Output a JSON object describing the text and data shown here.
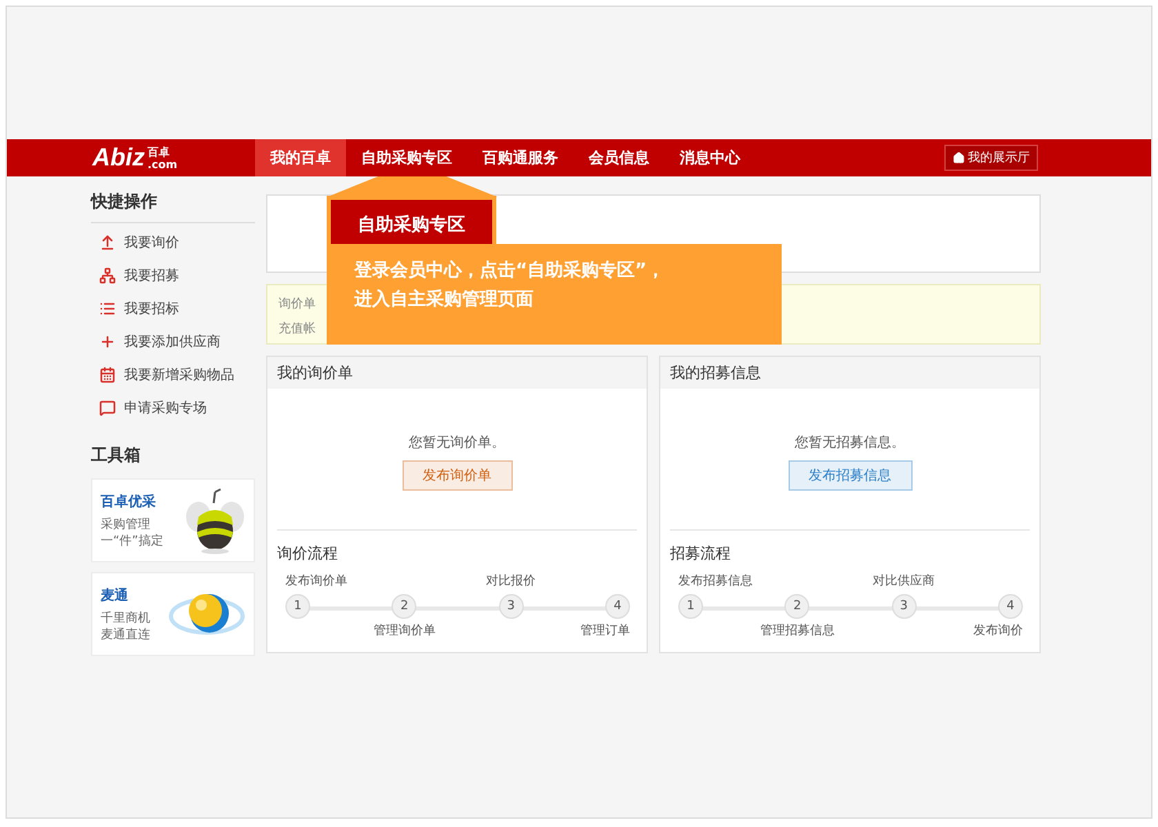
{
  "logo": {
    "mark": "Abiz",
    "name": "百卓",
    "domain": ".com"
  },
  "nav": [
    {
      "label": "我的百卓",
      "selected": true
    },
    {
      "label": "自助采购专区",
      "selected": false
    },
    {
      "label": "百购通服务",
      "selected": false
    },
    {
      "label": "会员信息",
      "selected": false
    },
    {
      "label": "消息中心",
      "selected": false
    }
  ],
  "showroom": "我的展示厅",
  "sidebar": {
    "quick_title": "快捷操作",
    "quick_items": [
      {
        "label": "我要询价",
        "kind": "upload"
      },
      {
        "label": "我要招募",
        "kind": "network"
      },
      {
        "label": "我要招标",
        "kind": "list"
      },
      {
        "label": "我要添加供应商",
        "kind": "plus"
      },
      {
        "label": "我要新增采购物品",
        "kind": "calendar"
      },
      {
        "label": "申请采购专场",
        "kind": "message"
      }
    ],
    "toolbox_title": "工具箱",
    "tools": [
      {
        "name": "百卓优采",
        "lines": [
          "采购管理",
          "一“件”搞定"
        ],
        "kind": "bee"
      },
      {
        "name": "麦通",
        "lines": [
          "千里商机",
          "麦通直连"
        ],
        "kind": "globe"
      }
    ]
  },
  "notice": [
    "询价单",
    "充值帐"
  ],
  "callout": {
    "tab": "自助采购专区",
    "lines": [
      "登录会员中心，点击“自助采购专区”，",
      "进入自主采购管理页面"
    ]
  },
  "panels": [
    {
      "title": "我的询价单",
      "empty": "您暂无询价单。",
      "button": "发布询价单",
      "color": "#d06010",
      "flow_title": "询价流程",
      "steps": [
        {
          "num": "1",
          "label": "发布询价单"
        },
        {
          "num": "2",
          "label": "管理询价单"
        },
        {
          "num": "3",
          "label": "对比报价"
        },
        {
          "num": "4",
          "label": "管理订单"
        }
      ]
    },
    {
      "title": "我的招募信息",
      "empty": "您暂无招募信息。",
      "button": "发布招募信息",
      "color": "#2a7fc8",
      "flow_title": "招募流程",
      "steps": [
        {
          "num": "1",
          "label": "发布招募信息"
        },
        {
          "num": "2",
          "label": "管理招募信息"
        },
        {
          "num": "3",
          "label": "对比供应商"
        },
        {
          "num": "4",
          "label": "发布询价"
        }
      ]
    }
  ]
}
